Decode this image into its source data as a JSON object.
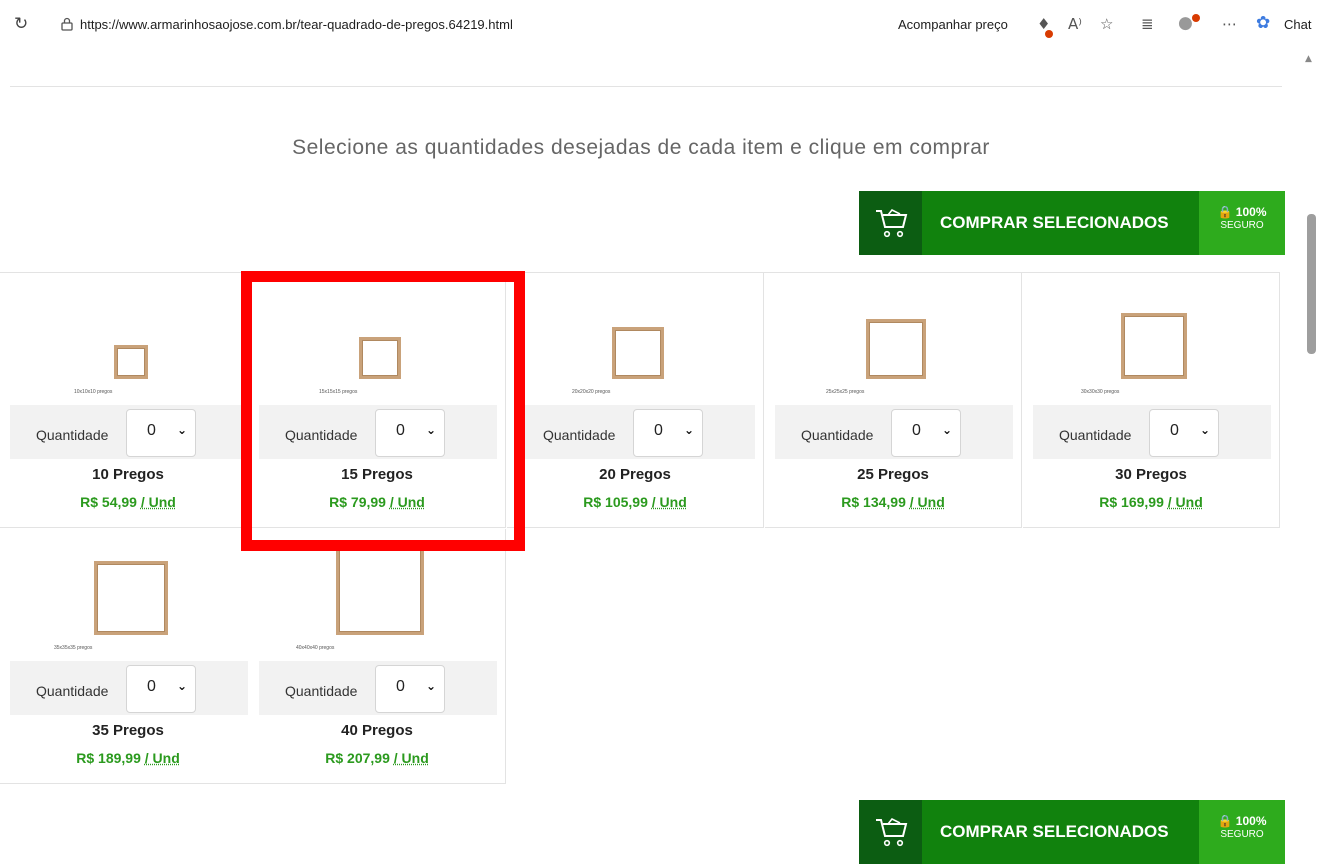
{
  "browser": {
    "url": "https://www.armarinhosaojose.com.br/tear-quadrado-de-pregos.64219.html",
    "track_price": "Acompanhar preço",
    "chat": "Chat"
  },
  "page": {
    "heading": "Selecione as quantidades desejadas de cada item e clique em comprar",
    "buy_label": "COMPRAR SELECIONADOS",
    "secure_pct": "100%",
    "secure_label": "SEGURO",
    "qty_label": "Quantidade"
  },
  "products": [
    {
      "caption": "10x10x10 pregos",
      "name": "10 Pregos",
      "price": "R$ 54,99",
      "unit": "/ Und",
      "qty": "0"
    },
    {
      "caption": "15x15x15 pregos",
      "name": "15 Pregos",
      "price": "R$ 79,99",
      "unit": "/ Und",
      "qty": "0"
    },
    {
      "caption": "20x20x20 pregos",
      "name": "20 Pregos",
      "price": "R$ 105,99",
      "unit": "/ Und",
      "qty": "0"
    },
    {
      "caption": "25x25x25 pregos",
      "name": "25 Pregos",
      "price": "R$ 134,99",
      "unit": "/ Und",
      "qty": "0"
    },
    {
      "caption": "30x30x30 pregos",
      "name": "30 Pregos",
      "price": "R$ 169,99",
      "unit": "/ Und",
      "qty": "0"
    },
    {
      "caption": "35x35x35 pregos",
      "name": "35 Pregos",
      "price": "R$ 189,99",
      "unit": "/ Und",
      "qty": "0"
    },
    {
      "caption": "40x40x40 pregos",
      "name": "40 Pregos",
      "price": "R$ 207,99",
      "unit": "/ Und",
      "qty": "0"
    }
  ],
  "colors": {
    "buy_green": "#11820d",
    "price_green": "#2b9a1e",
    "highlight": "#ff0000"
  }
}
